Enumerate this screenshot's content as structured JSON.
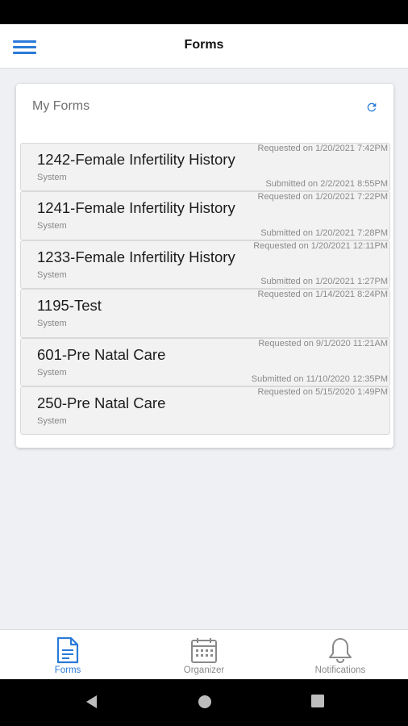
{
  "header": {
    "title": "Forms"
  },
  "card": {
    "title": "My Forms"
  },
  "forms": [
    {
      "name": "1242-Female Infertility History",
      "source": "System",
      "requested": "Requested on 1/20/2021 7:42PM",
      "submitted": "Submitted on 2/2/2021 8:55PM"
    },
    {
      "name": "1241-Female Infertility History",
      "source": "System",
      "requested": "Requested on 1/20/2021 7:22PM",
      "submitted": "Submitted on 1/20/2021 7:28PM"
    },
    {
      "name": "1233-Female Infertility History",
      "source": "System",
      "requested": "Requested on 1/20/2021 12:11PM",
      "submitted": "Submitted on 1/20/2021 1:27PM"
    },
    {
      "name": "1195-Test",
      "source": "System",
      "requested": "Requested on 1/14/2021 8:24PM",
      "submitted": ""
    },
    {
      "name": "601-Pre Natal Care",
      "source": "System",
      "requested": "Requested on 9/1/2020 11:21AM",
      "submitted": "Submitted on 11/10/2020 12:35PM"
    },
    {
      "name": "250-Pre Natal Care",
      "source": "System",
      "requested": "Requested on 5/15/2020 1:49PM",
      "submitted": ""
    }
  ],
  "nav": {
    "forms": "Forms",
    "organizer": "Organizer",
    "notifications": "Notifications"
  },
  "colors": {
    "accent": "#2a7ad8",
    "background": "#eef0f4",
    "row": "#f2f2f2"
  },
  "icons": {
    "menu": "hamburger-menu-icon",
    "refresh": "refresh-icon",
    "forms": "document-icon",
    "organizer": "calendar-icon",
    "notifications": "bell-icon"
  }
}
